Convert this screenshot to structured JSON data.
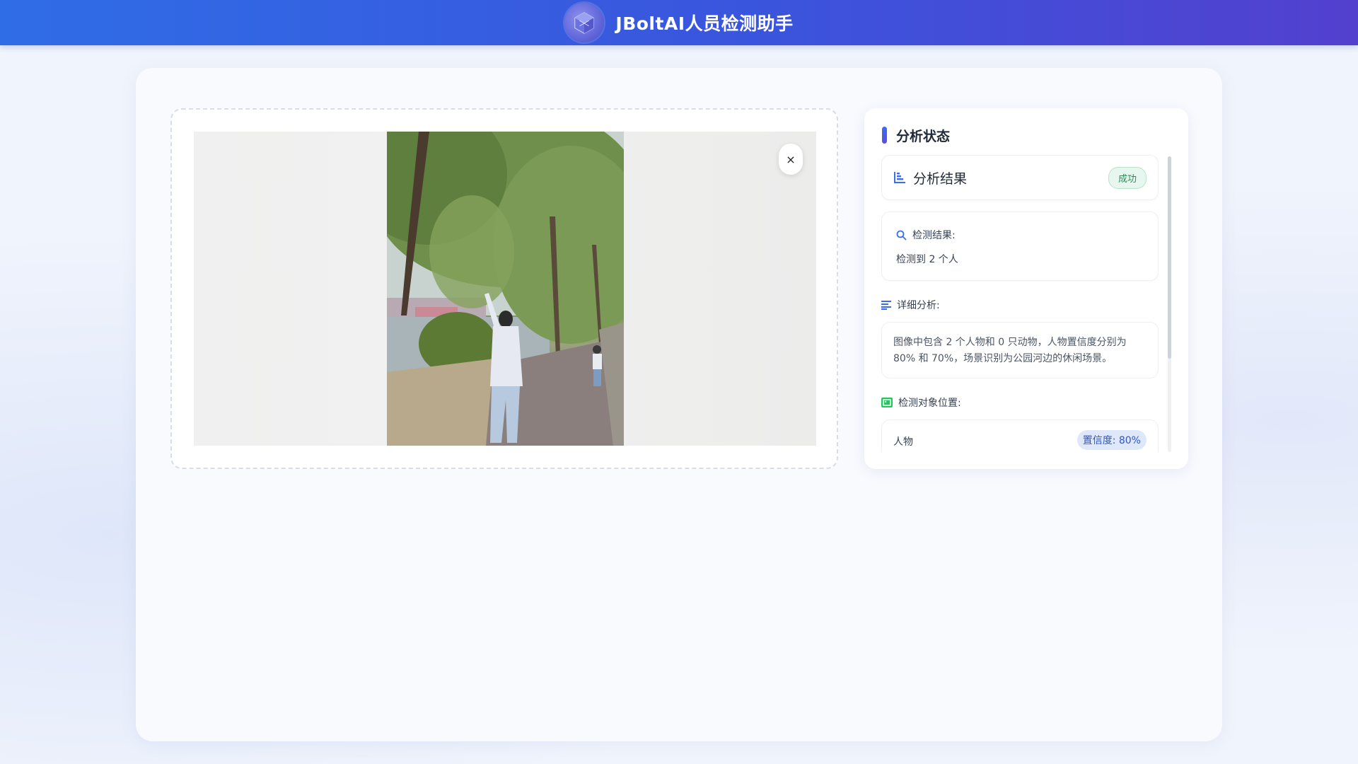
{
  "header": {
    "title": "JBoltAI人员检测助手",
    "logo_icon": "cube-logo-icon"
  },
  "upload": {
    "close_symbol": "×",
    "close_icon": "close-icon"
  },
  "status": {
    "title": "分析状态",
    "result_label": "分析结果",
    "result_badge": "成功",
    "detection_label": "检测结果:",
    "detection_text": "检测到 2 个人",
    "detail_label": "详细分析:",
    "detail_text": "图像中包含 2 个人物和 0 只动物，人物置信度分别为 80% 和 70%，场景识别为公园河边的休闲场景。",
    "position_label": "检测对象位置:",
    "objects": [
      {
        "name": "人物",
        "confidence": "置信度: 80%"
      }
    ]
  },
  "colors": {
    "header_start": "#2f6de6",
    "header_end": "#5340cf",
    "success": "#2e8b57",
    "accent": "#3a6df0"
  }
}
